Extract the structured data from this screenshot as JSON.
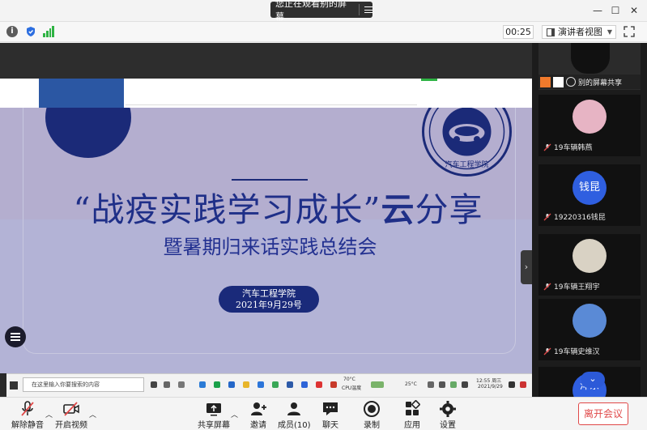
{
  "window": {
    "share_status": "您正在观看别的屏幕",
    "minimize": "—",
    "maximize": "☐",
    "close": "✕"
  },
  "toolbar": {
    "timer": "00:25",
    "view_mode": "演讲者视图"
  },
  "slide": {
    "emblem_text": "汽车工程学院",
    "title_main": "“战疫实践学习成长”",
    "title_yun": "云",
    "title_end": "分享",
    "subtitle": "暨暑期归来话实践总结会",
    "pill_line1": "汽车工程学院",
    "pill_line2": "2021年9月29号"
  },
  "taskbar": {
    "search_placeholder": "在这里输入你要搜索的内容",
    "weather_temp": "70°C",
    "weather_label": "CPU温度",
    "outside_temp": "25°C",
    "time": "12:55 周三",
    "date": "2021/9/29"
  },
  "gallery": {
    "sharer_label": "别的屏幕共享",
    "participants": [
      {
        "name": "19车辆韩燕",
        "avatar_text": ""
      },
      {
        "name": "19220316钱昆",
        "avatar_text": "钱昆"
      },
      {
        "name": "19车辆王翔宇",
        "avatar_text": ""
      },
      {
        "name": "19车辆史维汉",
        "avatar_text": ""
      }
    ],
    "partial_tile_text": "洋东"
  },
  "bottombar": {
    "unmute": "解除静音",
    "video": "开启视频",
    "share": "共享屏幕",
    "invite": "邀请",
    "members": "成员(10)",
    "chat": "聊天",
    "record": "录制",
    "apps": "应用",
    "settings": "设置",
    "leave": "离开会议"
  },
  "colors": {
    "slide_bg": "#b3b3d6",
    "navy": "#1b2a78",
    "leave_red": "#e04848",
    "accent_blue": "#2c5ad8"
  }
}
